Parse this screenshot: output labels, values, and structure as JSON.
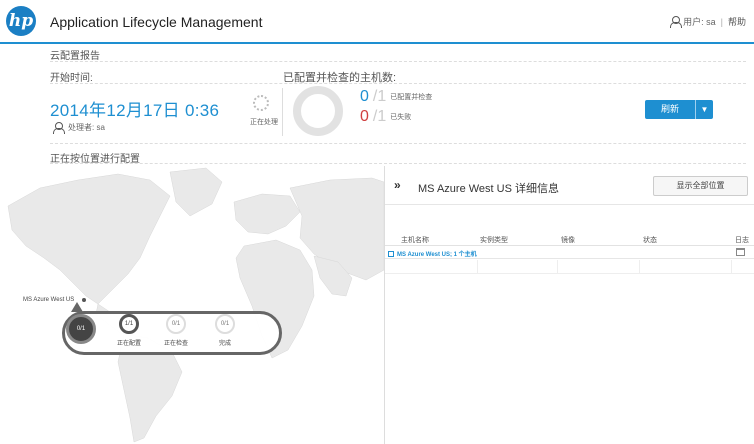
{
  "header": {
    "logo": "hp",
    "title": "Application Lifecycle Management",
    "user_label": "用户: sa",
    "separator": "|",
    "help_label": "帮助"
  },
  "report": {
    "title": "云配置报告",
    "start_label": "开始时间:",
    "hosts_label": "已配置并检查的主机数:",
    "start_time": "2014年12月17日 0:36",
    "processor_label": "处理者: sa",
    "processing_status": "正在处理",
    "configured_count": "0",
    "configured_total": "/1",
    "configured_label": "已配置并检查",
    "failed_count": "0",
    "failed_total": "/1",
    "failed_label": "已失败",
    "refresh_label": "刷新",
    "configuring_label": "正在按位置进行配置"
  },
  "map": {
    "region_label": "MS Azure West US",
    "stages": [
      {
        "value": "0/1",
        "label": ""
      },
      {
        "value": "1/1",
        "label": "正在配置"
      },
      {
        "value": "0/1",
        "label": "正在检查"
      },
      {
        "value": "0/1",
        "label": "完成"
      }
    ]
  },
  "details": {
    "expand_icon": "»",
    "title": "MS Azure West US 详细信息",
    "show_all_label": "显示全部位置",
    "columns": [
      "主机名称",
      "实例类型",
      "镜像",
      "状态",
      "日志"
    ],
    "group_row": "MS Azure West US; 1 个主机"
  },
  "colors": {
    "accent": "#1e8fd1",
    "failed": "#d04040"
  }
}
